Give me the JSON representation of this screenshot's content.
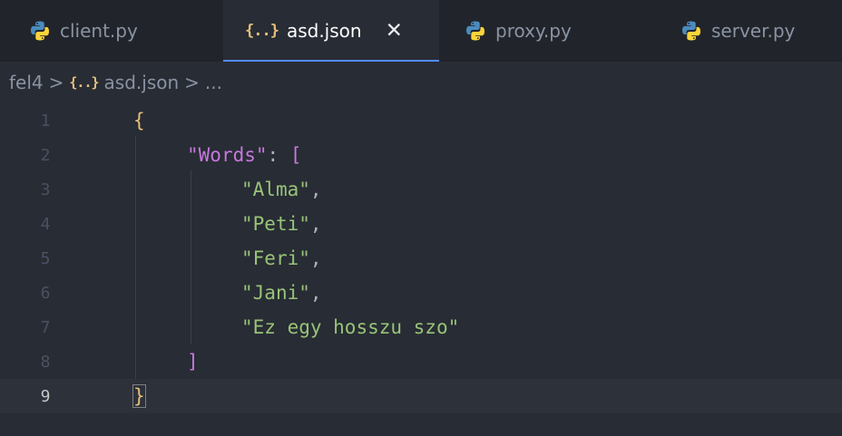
{
  "tabs": [
    {
      "label": "client.py",
      "icon": "python-icon",
      "active": false
    },
    {
      "label": "asd.json",
      "icon": "json-braces-icon",
      "active": true
    },
    {
      "label": "proxy.py",
      "icon": "python-icon",
      "active": false
    },
    {
      "label": "server.py",
      "icon": "python-icon",
      "active": false
    }
  ],
  "tab_close_glyph": "✕",
  "breadcrumb": {
    "folder": "fel4",
    "file": "asd.json",
    "ellipsis": "...",
    "separator": ">"
  },
  "json_icon_glyph": "{..}",
  "editor": {
    "current_line": 9,
    "line_numbers": [
      "1",
      "2",
      "3",
      "4",
      "5",
      "6",
      "7",
      "8",
      "9"
    ],
    "open_brace": "{",
    "close_brace": "}",
    "key": "Words",
    "open_bracket": "[",
    "close_bracket": "]",
    "words": [
      "Alma",
      "Peti",
      "Feri",
      "Jani",
      "Ez egy hosszu szo"
    ]
  },
  "colors": {
    "background": "#282c34",
    "tabbar": "#21252b",
    "active_tab_underline": "#528bff",
    "string": "#98c379",
    "key": "#c678dd",
    "brace": "#e5c07b",
    "bracket": "#61afef",
    "line_number": "#495162"
  }
}
